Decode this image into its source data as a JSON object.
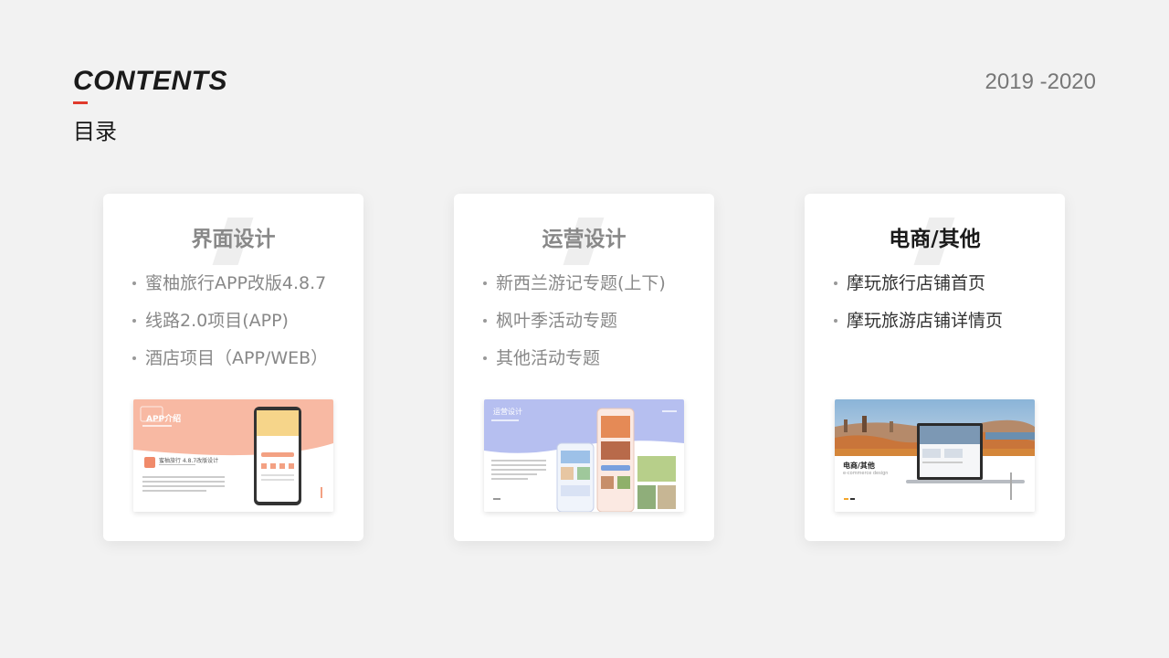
{
  "header": {
    "title": "CONTENTS",
    "subtitle": "目录",
    "year": "2019 -2020"
  },
  "colors": {
    "accent": "#e03a2c",
    "peach": "#f8b9a3",
    "lavender": "#b6bff0",
    "card_bg": "#ffffff",
    "page_bg": "#f2f2f2"
  },
  "cards": [
    {
      "title": "界面设计",
      "items": [
        "蜜柚旅行APP改版4.8.7",
        "线路2.0项目(APP)",
        "酒店项目（APP/WEB）"
      ],
      "thumb": {
        "tag": "APP介绍",
        "name": "蜜柚旅行 4.8.7改版设计"
      }
    },
    {
      "title": "运营设计",
      "items": [
        "新西兰游记专题(上下)",
        "枫叶季活动专题",
        "其他活动专题"
      ],
      "thumb": {
        "tag": "运营设计"
      }
    },
    {
      "title": "电商/其他",
      "items": [
        "摩玩旅行店铺首页",
        "摩玩旅游店铺详情页"
      ],
      "thumb": {
        "tag": "电商/其他",
        "sub": "e-commerce design"
      }
    }
  ]
}
